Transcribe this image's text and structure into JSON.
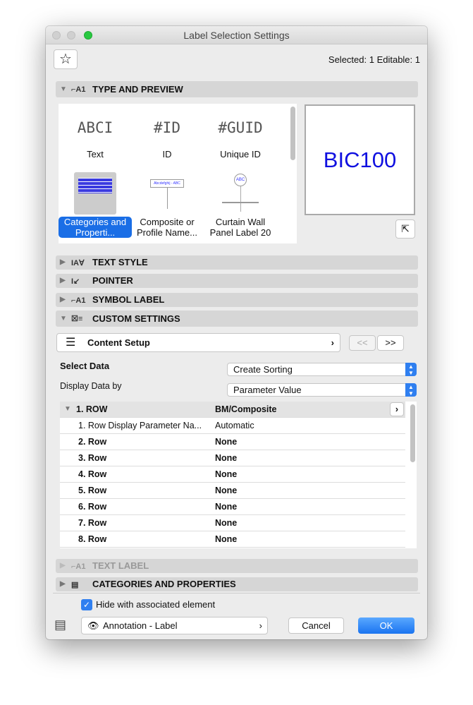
{
  "window": {
    "title": "Label Selection Settings"
  },
  "header": {
    "status": "Selected: 1 Editable: 1"
  },
  "sections": {
    "type_preview": "TYPE AND PREVIEW",
    "text_style": "TEXT STYLE",
    "pointer": "POINTER",
    "symbol_label": "SYMBOL LABEL",
    "custom_settings": "CUSTOM SETTINGS",
    "text_label": "TEXT LABEL",
    "categories_properties": "CATEGORIES AND PROPERTIES"
  },
  "types": [
    {
      "icon": "ABCI",
      "label": "Text"
    },
    {
      "icon": "#ID",
      "label": "ID"
    },
    {
      "icon": "#GUID",
      "label": "Unique ID"
    },
    {
      "label": "Categories and Properti..."
    },
    {
      "label": "Composite or Profile Name..."
    },
    {
      "label": "Curtain Wall Panel Label 20"
    }
  ],
  "preview": {
    "text": "BIC100",
    "color": "#1010e0"
  },
  "custom": {
    "content_setup": "Content Setup",
    "prev": "<<",
    "next": ">>",
    "select_data_label": "Select Data",
    "select_data_value": "Create Sorting",
    "display_by_label": "Display Data by",
    "display_by_value": "Parameter Value"
  },
  "table": {
    "header": {
      "c1": "1. ROW",
      "c2": "BM/Composite"
    },
    "rows": [
      {
        "c1": "1. Row Display Parameter Na...",
        "c2": "Automatic"
      },
      {
        "c1": "2. Row",
        "c2": "None"
      },
      {
        "c1": "3. Row",
        "c2": "None"
      },
      {
        "c1": "4. Row",
        "c2": "None"
      },
      {
        "c1": "5. Row",
        "c2": "None"
      },
      {
        "c1": "6. Row",
        "c2": "None"
      },
      {
        "c1": "7. Row",
        "c2": "None"
      },
      {
        "c1": "8. Row",
        "c2": "None"
      }
    ]
  },
  "footer": {
    "hide_label": "Hide with associated element",
    "hide_checked": true,
    "layer": "Annotation - Label",
    "cancel": "Cancel",
    "ok": "OK",
    "accent": "#2f7ff0"
  }
}
